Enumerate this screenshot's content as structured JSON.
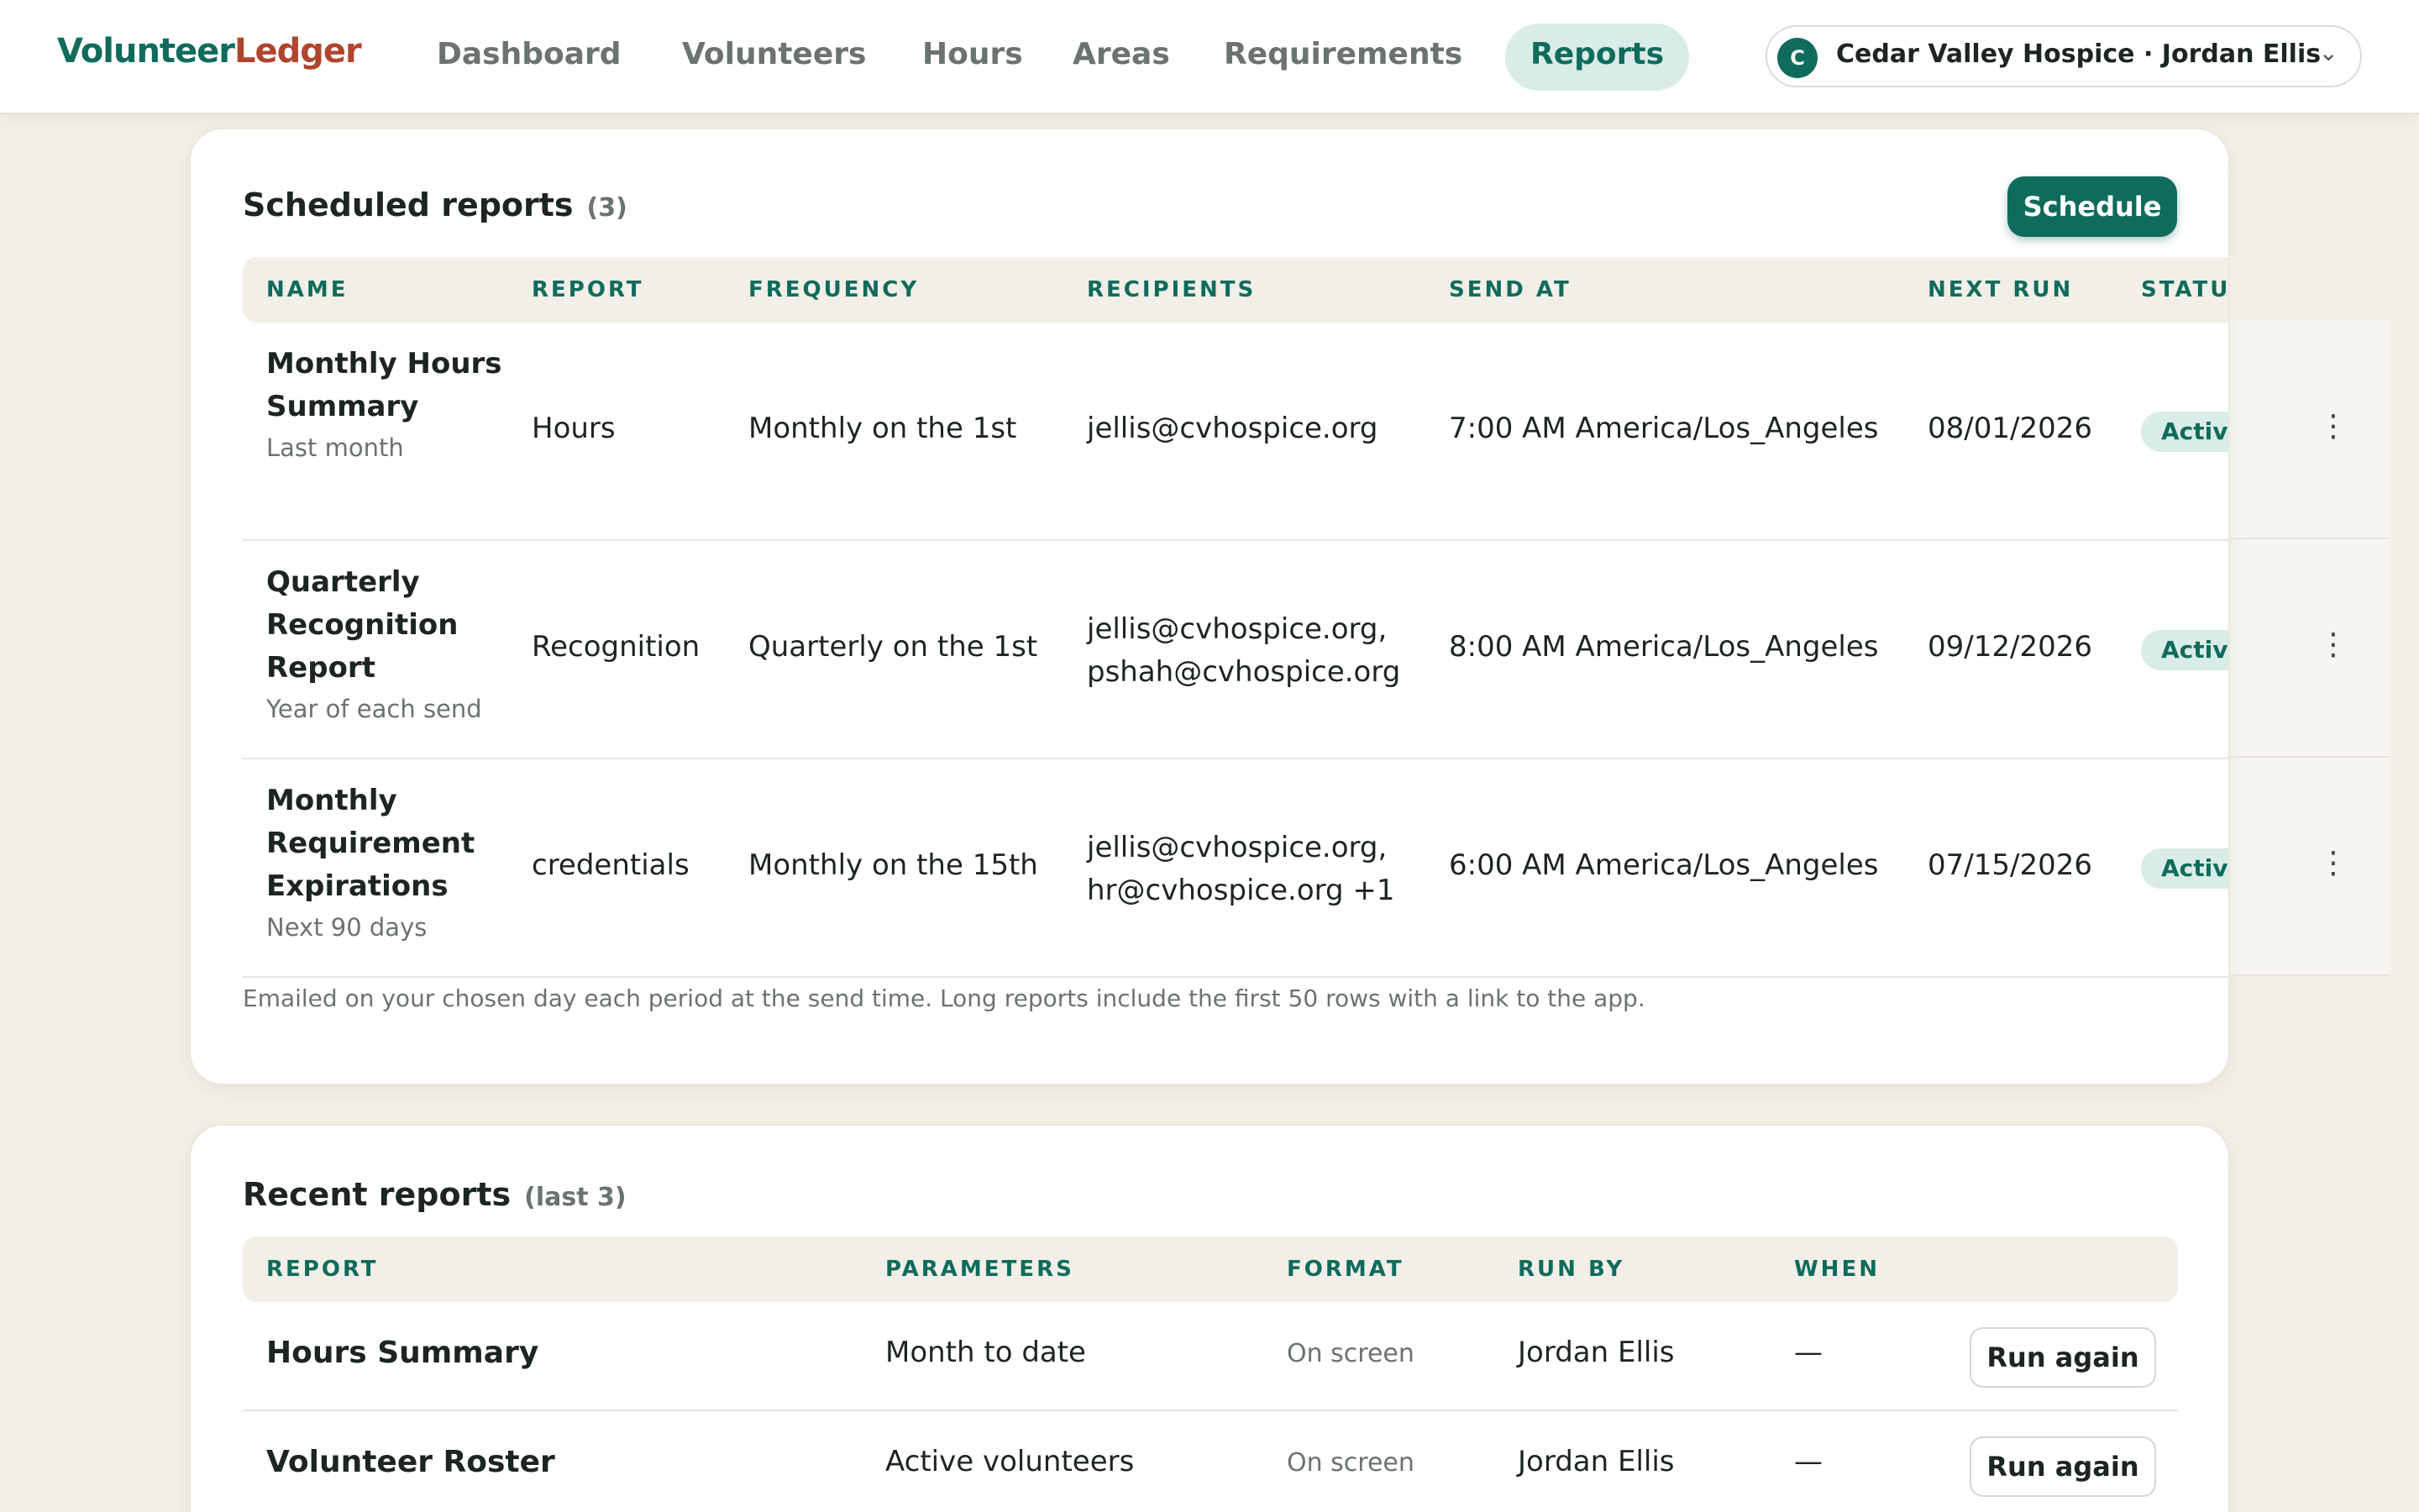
{
  "app": {
    "logo_part1": "Volunteer",
    "logo_part2": "Ledger"
  },
  "nav": {
    "items": [
      {
        "label": "Dashboard"
      },
      {
        "label": "Volunteers"
      },
      {
        "label": "Hours"
      },
      {
        "label": "Areas"
      },
      {
        "label": "Requirements"
      },
      {
        "label": "Reports",
        "active": true
      }
    ]
  },
  "org_switcher": {
    "avatar_letter": "C",
    "label": "Cedar Valley Hospice · Jordan Ellis",
    "chevron": "⌄",
    "icon": "chevron-down-icon"
  },
  "scheduled": {
    "title": "Scheduled reports",
    "count": "(3)",
    "schedule_button": "Schedule",
    "columns": [
      "NAME",
      "REPORT",
      "FREQUENCY",
      "RECIPIENTS",
      "SEND AT",
      "NEXT RUN",
      "STATUS"
    ],
    "rows": [
      {
        "name": "Monthly Hours Summary",
        "range": "Last month",
        "report": "Hours",
        "frequency": "Monthly on the 1st",
        "recipients_line1": "jellis@cvhospice.org",
        "recipients_line2": "",
        "send_at": "7:00 AM America/Los_Angeles",
        "next_run": "08/01/2026",
        "status": "Active"
      },
      {
        "name": "Quarterly Recognition Report",
        "range": "Year of each send",
        "report": "Recognition",
        "frequency": "Quarterly on the 1st",
        "recipients_line1": "jellis@cvhospice.org,",
        "recipients_line2": "pshah@cvhospice.org",
        "send_at": "8:00 AM America/Los_Angeles",
        "next_run": "09/12/2026",
        "status": "Active"
      },
      {
        "name": "Monthly Requirement Expirations",
        "range": "Next 90 days",
        "report": "credentials",
        "frequency": "Monthly on the 15th",
        "recipients_line1": "jellis@cvhospice.org,",
        "recipients_line2": "hr@cvhospice.org +1",
        "send_at": "6:00 AM America/Los_Angeles",
        "next_run": "07/15/2026",
        "status": "Active"
      }
    ],
    "footnote": "Emailed on your chosen day each period at the send time. Long reports include the first 50 rows with a link to the app.",
    "kebab_glyph": "⋮"
  },
  "recent": {
    "title": "Recent reports",
    "count": "(last 3)",
    "columns": [
      "REPORT",
      "PARAMETERS",
      "FORMAT",
      "RUN BY",
      "WHEN"
    ],
    "rows": [
      {
        "report": "Hours Summary",
        "parameters": "Month to date",
        "format": "On screen",
        "run_by": "Jordan Ellis",
        "when": "—",
        "action": "Run again"
      },
      {
        "report": "Volunteer Roster",
        "parameters": "Active volunteers",
        "format": "On screen",
        "run_by": "Jordan Ellis",
        "when": "—",
        "action": "Run again"
      }
    ]
  },
  "colors": {
    "brand": "#0f6b5c",
    "brand_accent": "#b0452e",
    "background": "#f3f0e8",
    "badge_bg": "#d9ece7"
  }
}
